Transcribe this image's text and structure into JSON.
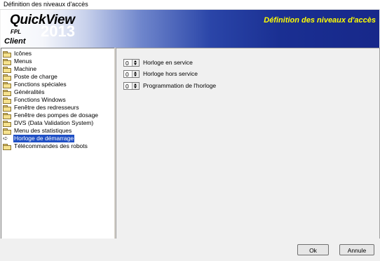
{
  "window": {
    "title": "Définition des niveaux d'accès"
  },
  "header": {
    "logo_name": "QuickView",
    "logo_sub": "FPL",
    "logo_year": "2013",
    "logo_section": "Client",
    "title": "Définition des niveaux d'accès",
    "title_color": "#ffff00"
  },
  "tree": {
    "items": [
      {
        "label": "Icônes",
        "icon": "folder-icon"
      },
      {
        "label": "Menus",
        "icon": "folder-icon"
      },
      {
        "label": "Machine",
        "icon": "folder-icon"
      },
      {
        "label": "Poste de charge",
        "icon": "folder-icon"
      },
      {
        "label": "Fonctions spéciales",
        "icon": "folder-icon"
      },
      {
        "label": "Généralités",
        "icon": "folder-icon"
      },
      {
        "label": "Fonctions Windows",
        "icon": "folder-icon"
      },
      {
        "label": "Fenêtre des redresseurs",
        "icon": "folder-icon"
      },
      {
        "label": "Fenêtre des pompes de dosage",
        "icon": "folder-icon"
      },
      {
        "label": "DVS (Data Validation System)",
        "icon": "folder-icon"
      },
      {
        "label": "Menu des statistiques",
        "icon": "folder-icon"
      },
      {
        "label": "Horloge de démarrage",
        "icon": "arrow-icon",
        "selected": true
      },
      {
        "label": "Télécommandes des robots",
        "icon": "folder-icon"
      }
    ]
  },
  "settings": [
    {
      "value": "0",
      "label": "Horloge en service"
    },
    {
      "value": "0",
      "label": "Horloge hors service"
    },
    {
      "value": "0",
      "label": "Programmation de l'horloge"
    }
  ],
  "buttons": {
    "ok": "Ok",
    "cancel": "Annule"
  },
  "colors": {
    "selection": "#1f4fc4",
    "header_dark": "#17288a"
  }
}
